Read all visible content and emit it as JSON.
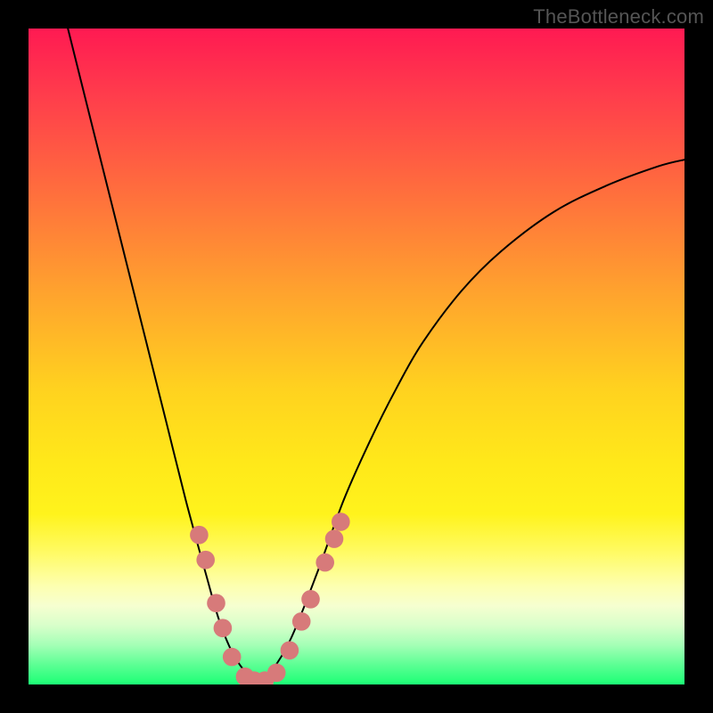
{
  "watermark": {
    "text": "TheBottleneck.com"
  },
  "chart_data": {
    "type": "line",
    "title": "",
    "xlabel": "",
    "ylabel": "",
    "xlim": [
      0,
      1
    ],
    "ylim": [
      0,
      1
    ],
    "legend": false,
    "gradient_stops": [
      {
        "pos": 0.0,
        "color": "#ff1a52"
      },
      {
        "pos": 0.1,
        "color": "#ff3c4c"
      },
      {
        "pos": 0.24,
        "color": "#ff6b3e"
      },
      {
        "pos": 0.4,
        "color": "#ffa22e"
      },
      {
        "pos": 0.55,
        "color": "#ffd21f"
      },
      {
        "pos": 0.66,
        "color": "#ffe81a"
      },
      {
        "pos": 0.74,
        "color": "#fff31c"
      },
      {
        "pos": 0.8,
        "color": "#fffb66"
      },
      {
        "pos": 0.85,
        "color": "#fdffb0"
      },
      {
        "pos": 0.88,
        "color": "#f6ffd0"
      },
      {
        "pos": 0.91,
        "color": "#d8ffca"
      },
      {
        "pos": 0.94,
        "color": "#a4ffb6"
      },
      {
        "pos": 0.97,
        "color": "#5cff94"
      },
      {
        "pos": 1.0,
        "color": "#1cff75"
      }
    ],
    "series": [
      {
        "name": "bottleneck-curve",
        "color": "#000000",
        "x": [
          0.06,
          0.09,
          0.12,
          0.15,
          0.18,
          0.21,
          0.24,
          0.27,
          0.29,
          0.31,
          0.33,
          0.35,
          0.37,
          0.4,
          0.44,
          0.48,
          0.52,
          0.56,
          0.6,
          0.66,
          0.72,
          0.8,
          0.88,
          0.96,
          1.0
        ],
        "y": [
          1.0,
          0.88,
          0.76,
          0.64,
          0.52,
          0.4,
          0.28,
          0.17,
          0.1,
          0.05,
          0.02,
          0.005,
          0.02,
          0.07,
          0.17,
          0.28,
          0.37,
          0.45,
          0.52,
          0.6,
          0.66,
          0.72,
          0.76,
          0.79,
          0.8
        ]
      }
    ],
    "markers": {
      "name": "highlight-dots",
      "color": "#d77a7a",
      "radius_norm": 0.014,
      "points": [
        {
          "x": 0.26,
          "y": 0.228
        },
        {
          "x": 0.27,
          "y": 0.19
        },
        {
          "x": 0.286,
          "y": 0.124
        },
        {
          "x": 0.296,
          "y": 0.086
        },
        {
          "x": 0.31,
          "y": 0.042
        },
        {
          "x": 0.33,
          "y": 0.012
        },
        {
          "x": 0.344,
          "y": 0.006
        },
        {
          "x": 0.36,
          "y": 0.006
        },
        {
          "x": 0.378,
          "y": 0.018
        },
        {
          "x": 0.398,
          "y": 0.052
        },
        {
          "x": 0.416,
          "y": 0.096
        },
        {
          "x": 0.43,
          "y": 0.13
        },
        {
          "x": 0.452,
          "y": 0.186
        },
        {
          "x": 0.466,
          "y": 0.222
        },
        {
          "x": 0.476,
          "y": 0.248
        }
      ]
    }
  }
}
